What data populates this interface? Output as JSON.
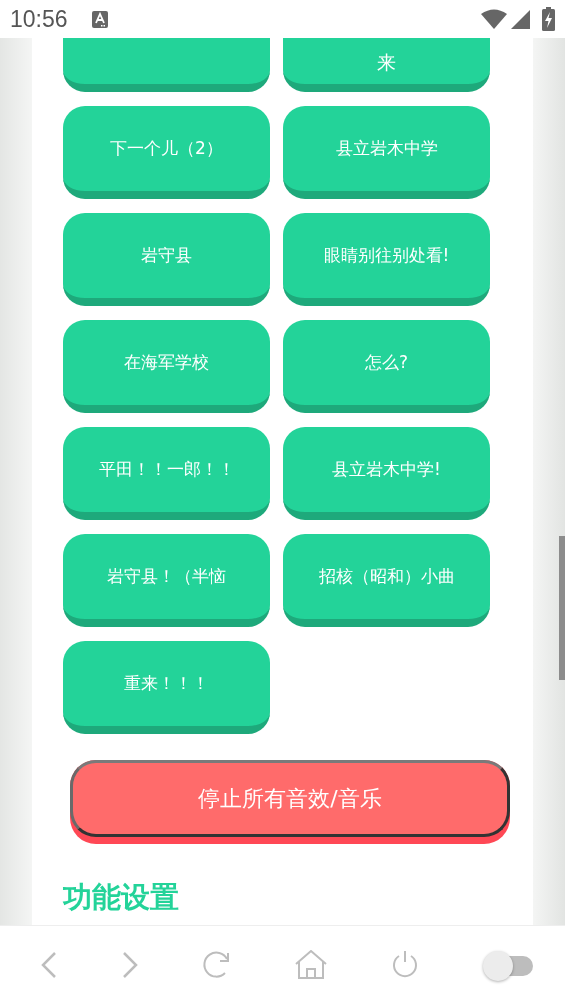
{
  "status_bar": {
    "time": "10:56"
  },
  "sound_buttons": [
    {
      "kind": "clipped"
    },
    {
      "kind": "clipped",
      "label": "来"
    },
    {
      "kind": "normal",
      "label": "下一个儿（2）"
    },
    {
      "kind": "normal",
      "label": "县立岩木中学"
    },
    {
      "kind": "normal",
      "label": "岩守县"
    },
    {
      "kind": "normal",
      "label": "眼睛别往别处看!"
    },
    {
      "kind": "normal",
      "label": "在海军学校"
    },
    {
      "kind": "normal",
      "label": "怎么?"
    },
    {
      "kind": "normal",
      "label": "平田！！一郎！！"
    },
    {
      "kind": "normal",
      "label": "县立岩木中学!"
    },
    {
      "kind": "normal",
      "label": "岩守县！（半恼"
    },
    {
      "kind": "normal",
      "label": "招核（昭和）小曲"
    },
    {
      "kind": "normal",
      "label": "重来！！！"
    }
  ],
  "stop_button": {
    "label": "停止所有音效/音乐"
  },
  "section_title": "功能设置",
  "bottom_nav": {
    "toggle": {
      "on": false
    }
  }
}
